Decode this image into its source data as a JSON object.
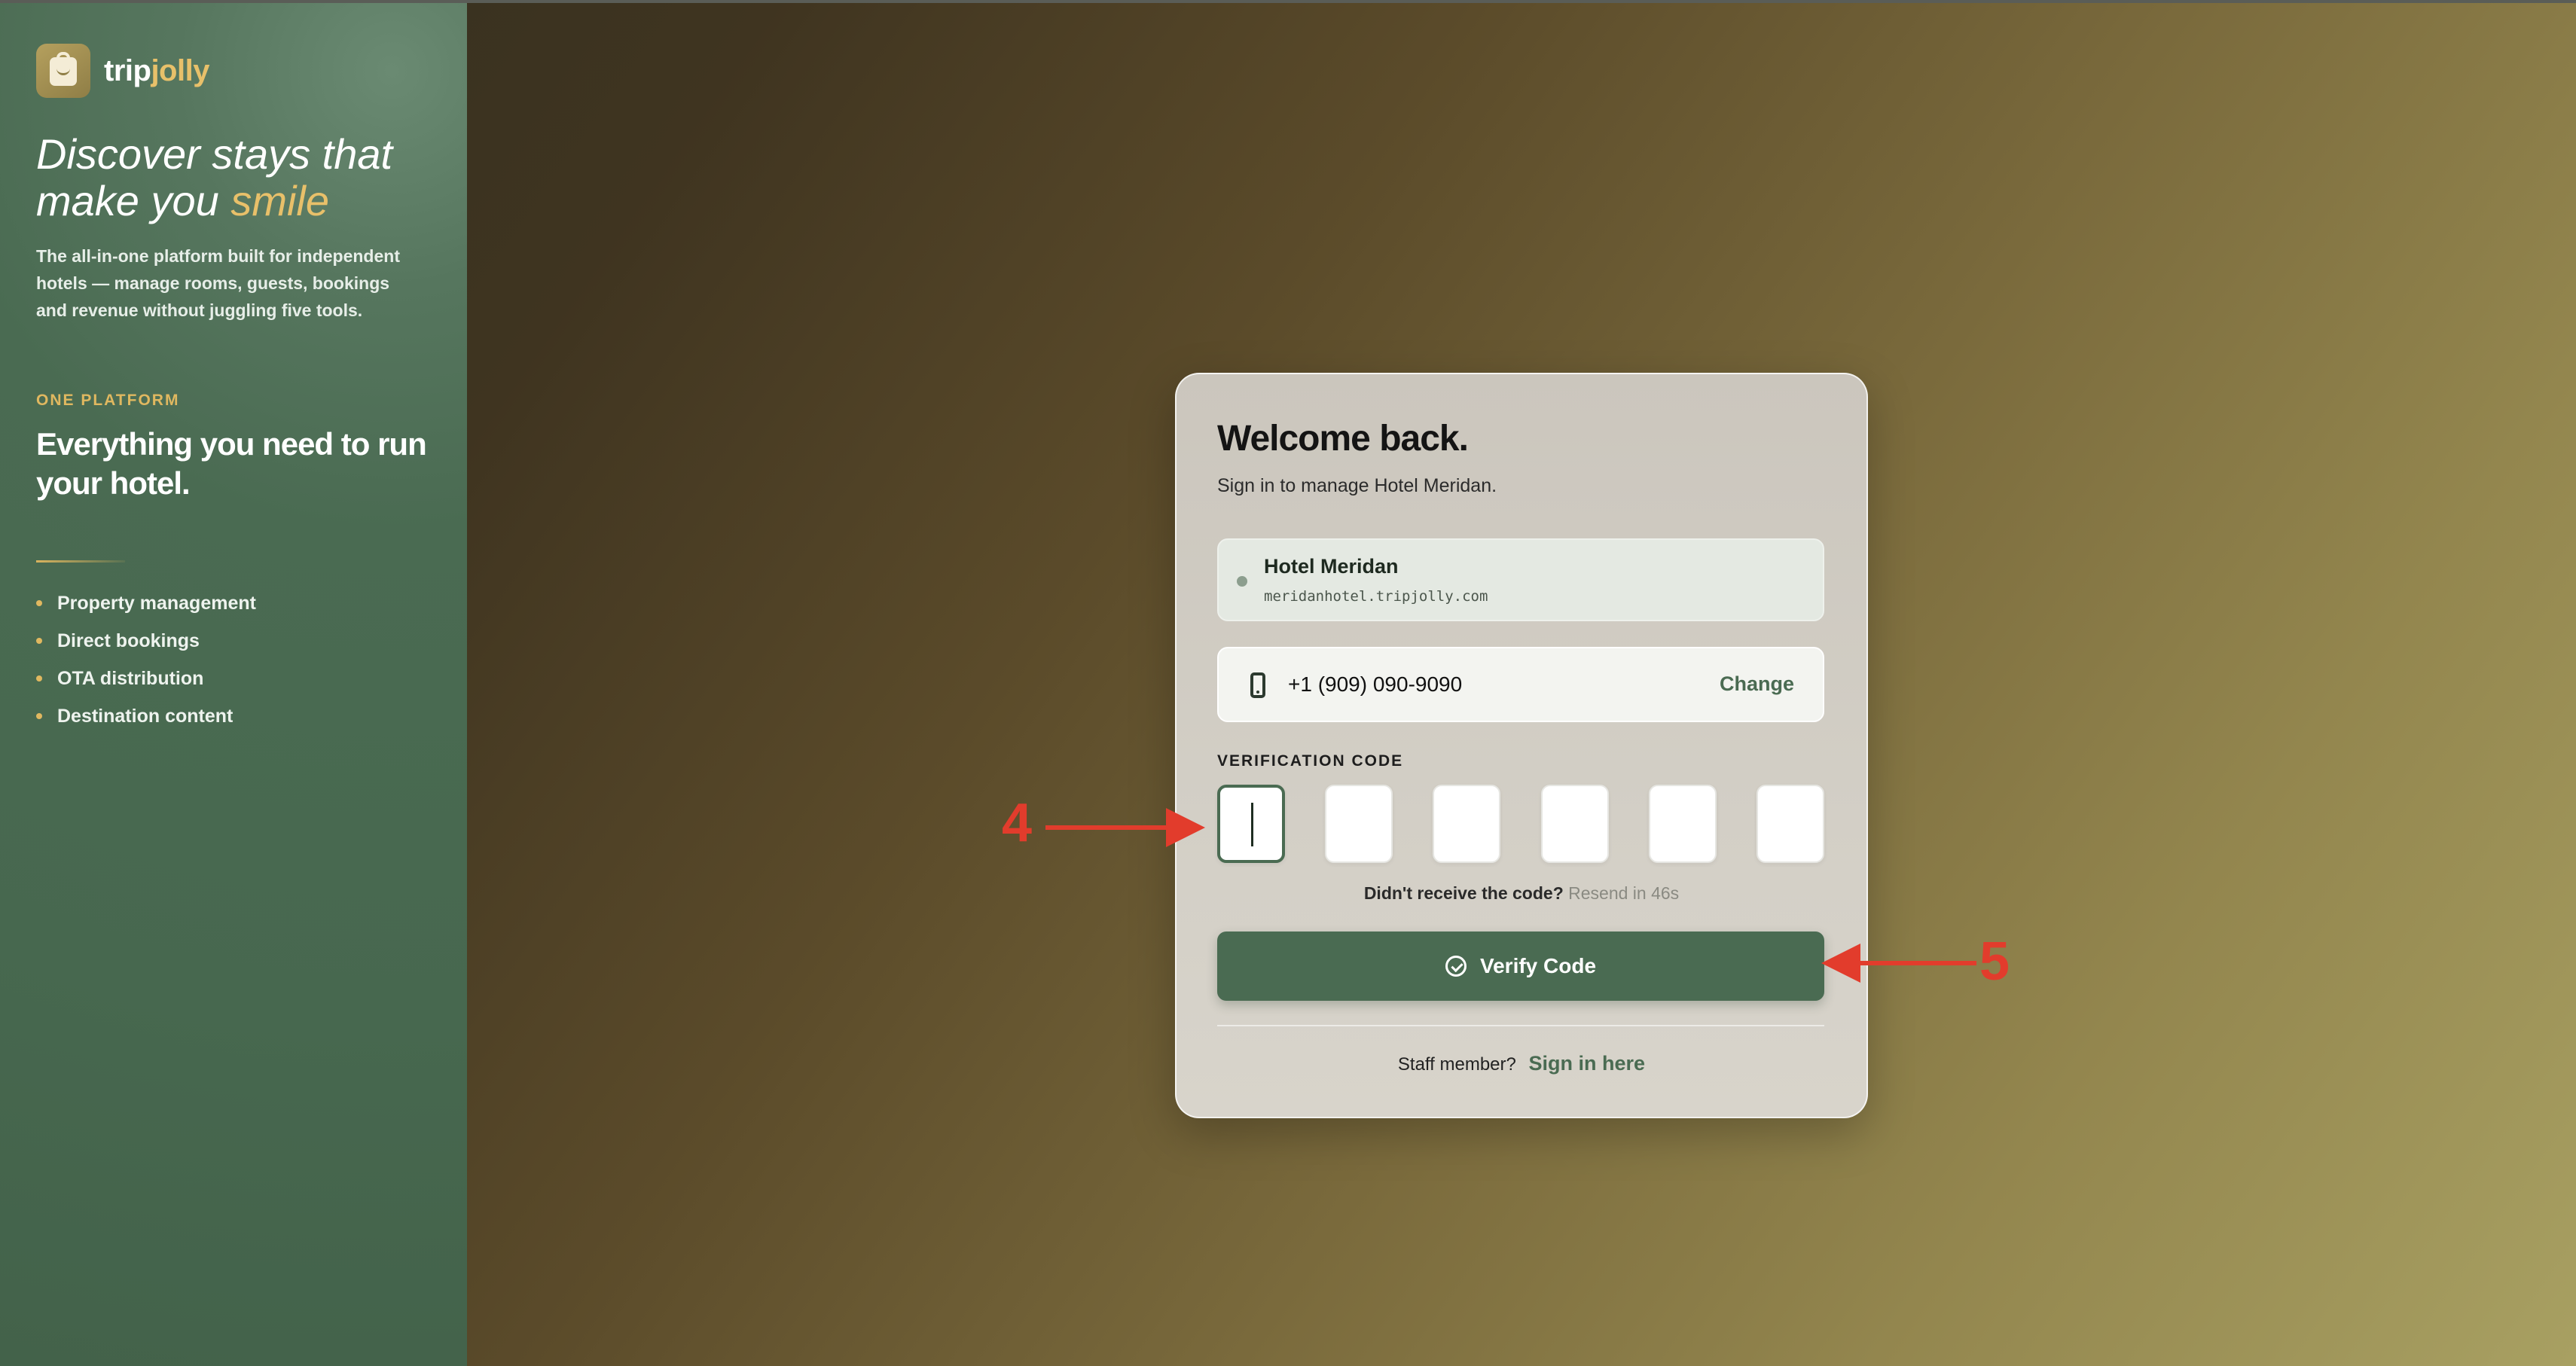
{
  "brand": {
    "name_part1": "trip",
    "name_part2": "jolly",
    "accent_color": "#e8c06a",
    "primary_color": "#4a6b52"
  },
  "sidebar": {
    "headline_line1": "Discover stays that",
    "headline_line2_prefix": "make you ",
    "headline_line2_accent": "smile",
    "description": "The all-in-one platform built for independent hotels — manage rooms, guests, bookings and revenue without juggling five tools.",
    "eyebrow": "ONE PLATFORM",
    "big_heading_line1": "Everything you need to run",
    "big_heading_line2": "your hotel.",
    "features": [
      "Property management",
      "Direct bookings",
      "OTA distribution",
      "Destination content"
    ]
  },
  "card": {
    "title": "Welcome back.",
    "subtitle": "Sign in to manage Hotel Meridan.",
    "hotel": {
      "name": "Hotel Meridan",
      "url": "meridanhotel.tripjolly.com"
    },
    "phone": {
      "number": "+1 (909) 090-9090",
      "change_label": "Change",
      "icon": "phone-icon"
    },
    "verification": {
      "label": "VERIFICATION CODE",
      "digits": [
        "",
        "",
        "",
        "",
        "",
        ""
      ]
    },
    "resend": {
      "prompt": "Didn't receive the code?",
      "countdown": "Resend in 46s"
    },
    "verify_button": {
      "label": "Verify Code",
      "icon": "check-circle-icon"
    },
    "staff": {
      "prompt": "Staff member?",
      "link": "Sign in here"
    }
  },
  "annotations": {
    "marker_1": "4",
    "marker_2": "5",
    "color": "#e23c2c"
  }
}
